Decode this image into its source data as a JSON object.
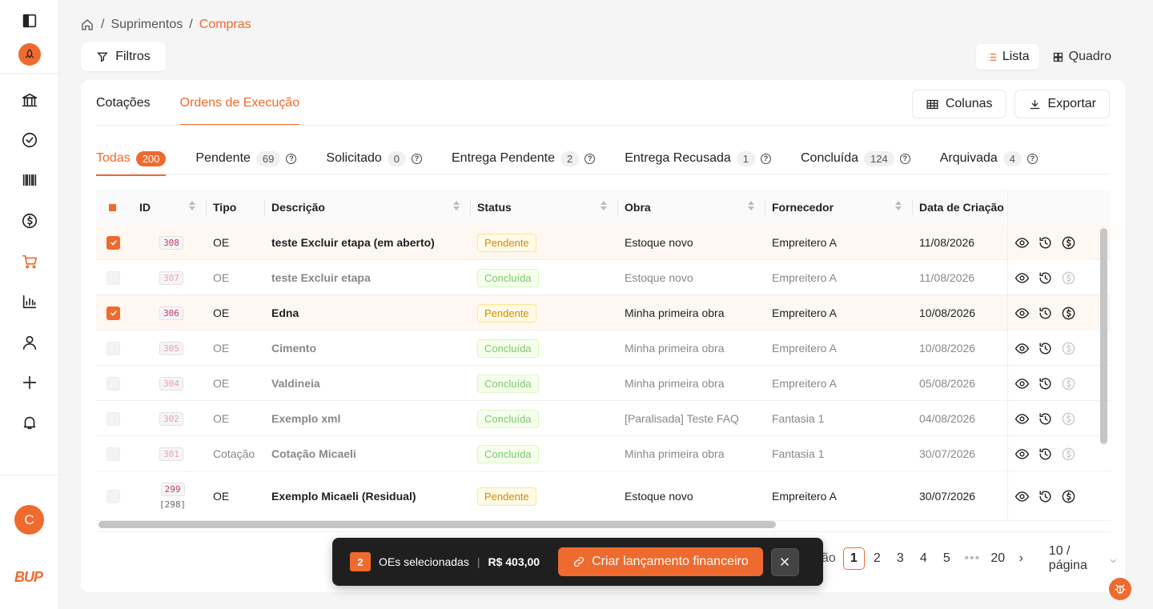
{
  "breadcrumb": {
    "items": [
      "Suprimentos",
      "Compras"
    ]
  },
  "filters_label": "Filtros",
  "view_switch": {
    "list": "Lista",
    "board": "Quadro"
  },
  "tabs": [
    {
      "label": "Cotações"
    },
    {
      "label": "Ordens de Execução"
    }
  ],
  "actions": {
    "columns": "Colunas",
    "export": "Exportar"
  },
  "status_tabs": [
    {
      "label": "Todas",
      "count": "200"
    },
    {
      "label": "Pendente",
      "count": "69"
    },
    {
      "label": "Solicitado",
      "count": "0"
    },
    {
      "label": "Entrega Pendente",
      "count": "2"
    },
    {
      "label": "Entrega Recusada",
      "count": "1"
    },
    {
      "label": "Concluída",
      "count": "124"
    },
    {
      "label": "Arquivada",
      "count": "4"
    }
  ],
  "table": {
    "headers": {
      "id": "ID",
      "tipo": "Tipo",
      "descricao": "Descrição",
      "status": "Status",
      "obra": "Obra",
      "fornecedor": "Fornecedor",
      "data": "Data de Criação"
    },
    "rows": [
      {
        "id": "308",
        "tipo": "OE",
        "descricao": "teste Excluir etapa (em aberto)",
        "status": "Pendente",
        "obra": "Estoque novo",
        "fornecedor": "Empreitero A",
        "data": "11/08/2026"
      },
      {
        "id": "307",
        "tipo": "OE",
        "descricao": "teste Excluir etapa",
        "status": "Concluída",
        "obra": "Estoque novo",
        "fornecedor": "Empreitero A",
        "data": "11/08/2026"
      },
      {
        "id": "306",
        "tipo": "OE",
        "descricao": "Edna",
        "status": "Pendente",
        "obra": "Minha primeira obra",
        "fornecedor": "Empreitero A",
        "data": "10/08/2026"
      },
      {
        "id": "305",
        "tipo": "OE",
        "descricao": "Cimento",
        "status": "Concluída",
        "obra": "Minha primeira obra",
        "fornecedor": "Empreitero A",
        "data": "10/08/2026"
      },
      {
        "id": "304",
        "tipo": "OE",
        "descricao": "Valdineia",
        "status": "Concluída",
        "obra": "Minha primeira obra",
        "fornecedor": "Empreitero A",
        "data": "05/08/2026"
      },
      {
        "id": "302",
        "tipo": "OE",
        "descricao": "Exemplo xml",
        "status": "Concluída",
        "obra": "[Paralisada] Teste FAQ",
        "fornecedor": "Fantasia 1",
        "data": "04/08/2026"
      },
      {
        "id": "301",
        "tipo": "Cotação",
        "descricao": "Cotação Micaeli",
        "status": "Concluída",
        "obra": "Minha primeira obra",
        "fornecedor": "Fantasia 1",
        "data": "30/07/2026"
      },
      {
        "id": "299",
        "sub_id": "[298]",
        "tipo": "OE",
        "descricao": "Exemplo Micaeli (Residual)",
        "status": "Pendente",
        "obra": "Estoque novo",
        "fornecedor": "Empreitero A",
        "data": "30/07/2026"
      }
    ]
  },
  "pagination": {
    "pages": [
      "1",
      "2",
      "3",
      "4",
      "5",
      "20"
    ],
    "page_size": "10 / página",
    "hidden_prefix": "ão"
  },
  "selection_bar": {
    "count": "2",
    "label": "OEs selecionadas",
    "amount": "R$ 403,00",
    "action": "Criar lançamento financeiro"
  },
  "user": {
    "initial": "C"
  },
  "brand": "BUP"
}
